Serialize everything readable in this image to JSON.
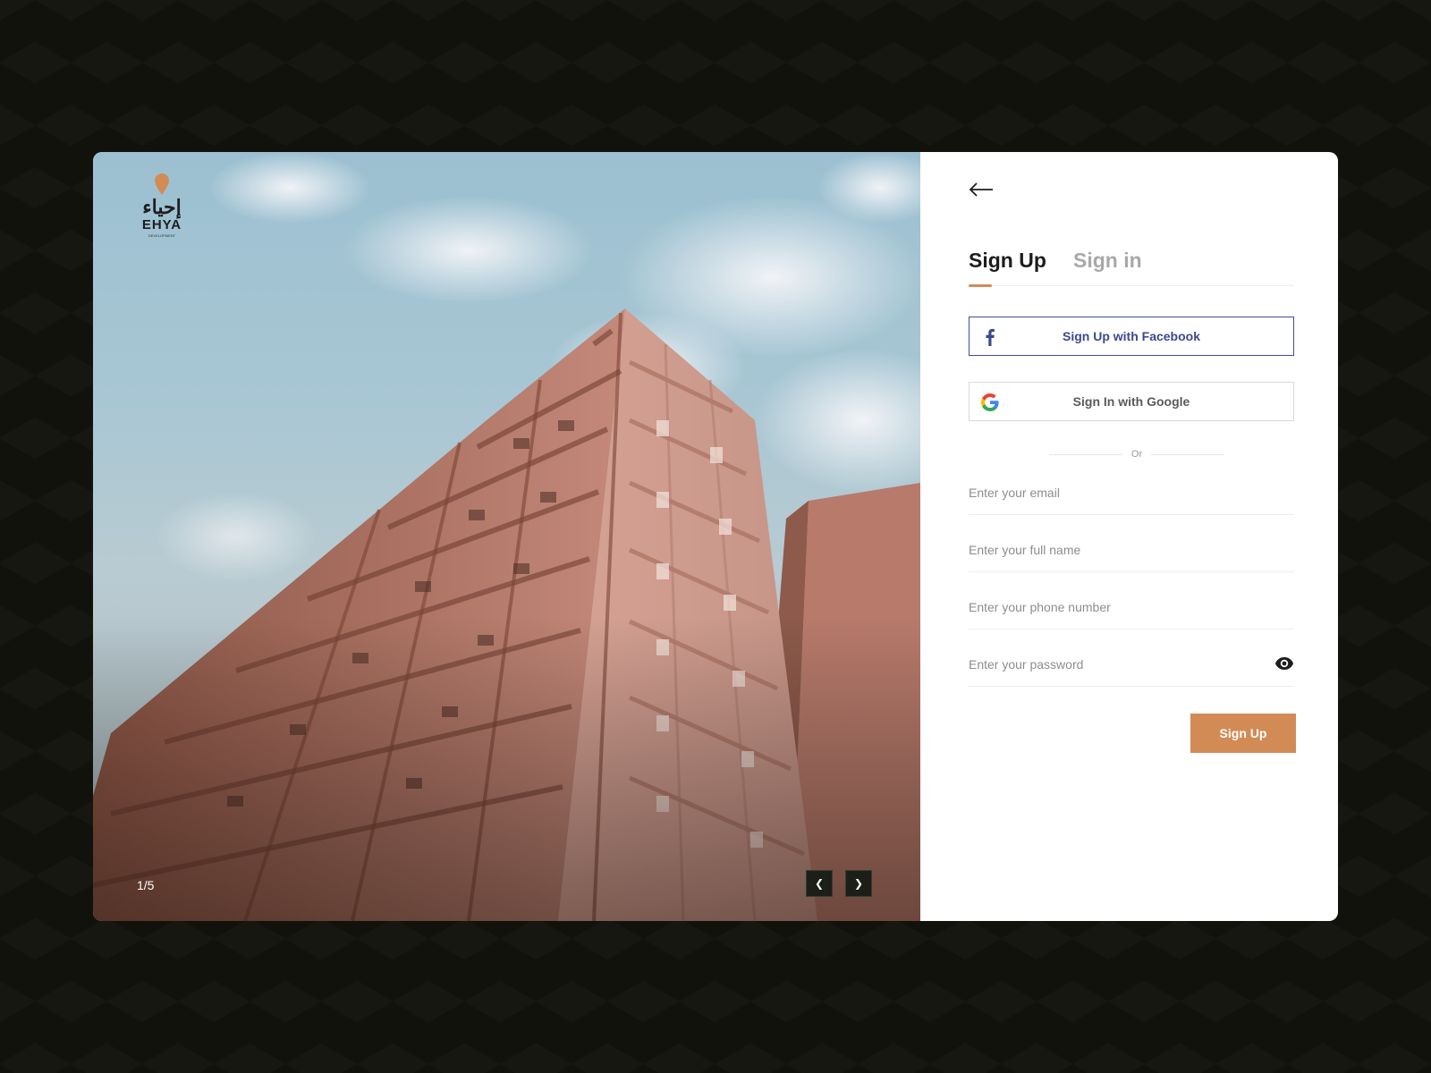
{
  "hero": {
    "logo": {
      "arabic": "إحياء",
      "latin": "EHYA",
      "subtitle": "DEVELOPMENT"
    },
    "slide_counter": "1/5",
    "prev_icon": "chevron-left",
    "next_icon": "chevron-right"
  },
  "panel": {
    "back_icon": "arrow-left",
    "tabs": [
      {
        "label": "Sign Up",
        "active": true
      },
      {
        "label": "Sign in",
        "active": false
      }
    ],
    "facebook_button": "Sign Up with Facebook",
    "google_button": "Sign In with Google",
    "divider_text": "Or",
    "fields": {
      "email_placeholder": "Enter your email",
      "name_placeholder": "Enter your full name",
      "phone_placeholder": "Enter your phone number",
      "password_placeholder": "Enter your password"
    },
    "submit_label": "Sign Up"
  },
  "colors": {
    "accent": "#d28b55",
    "facebook": "#3a4a8c",
    "background": "#12120d"
  }
}
